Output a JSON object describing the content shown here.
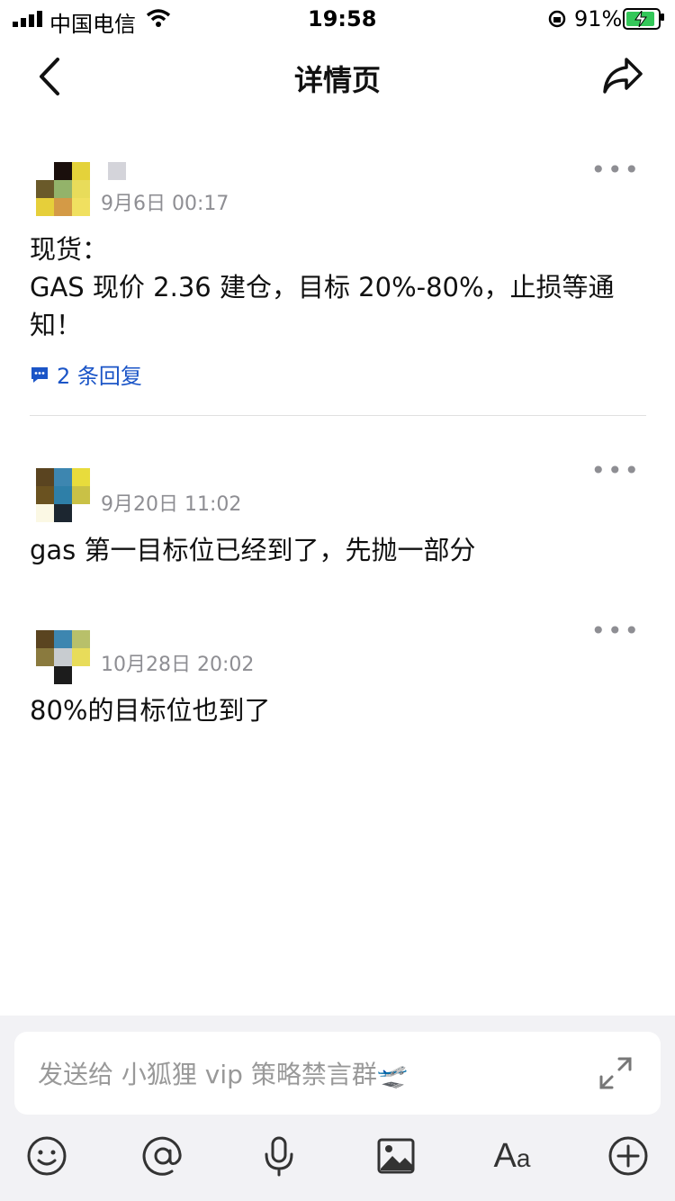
{
  "status_bar": {
    "carrier": "中国电信",
    "time": "19:58",
    "battery": "91%"
  },
  "nav": {
    "title": "详情页"
  },
  "posts": [
    {
      "date": "9月6日 00:17",
      "content": "现货：\nGAS 现价 2.36 建仓，目标 20%-80%，止损等通知！",
      "replies": "2 条回复"
    },
    {
      "date": "9月20日 11:02",
      "content": "gas 第一目标位已经到了，先抛一部分"
    },
    {
      "date": "10月28日 20:02",
      "content": "80%的目标位也到了"
    }
  ],
  "composer": {
    "placeholder": "发送给 小狐狸 vip 策略禁言群🛫"
  },
  "icons": {
    "back": "chevron-left-icon",
    "share": "share-icon",
    "more": "more-icon",
    "comment": "comment-icon",
    "expand": "expand-icon",
    "emoji": "emoji-icon",
    "mention": "at-icon",
    "voice": "mic-icon",
    "image": "image-icon",
    "text_format": "text-format-icon",
    "add": "plus-circle-icon"
  },
  "colors": {
    "link": "#1b55c7",
    "muted": "#8e8e93",
    "battery": "#34c759"
  }
}
